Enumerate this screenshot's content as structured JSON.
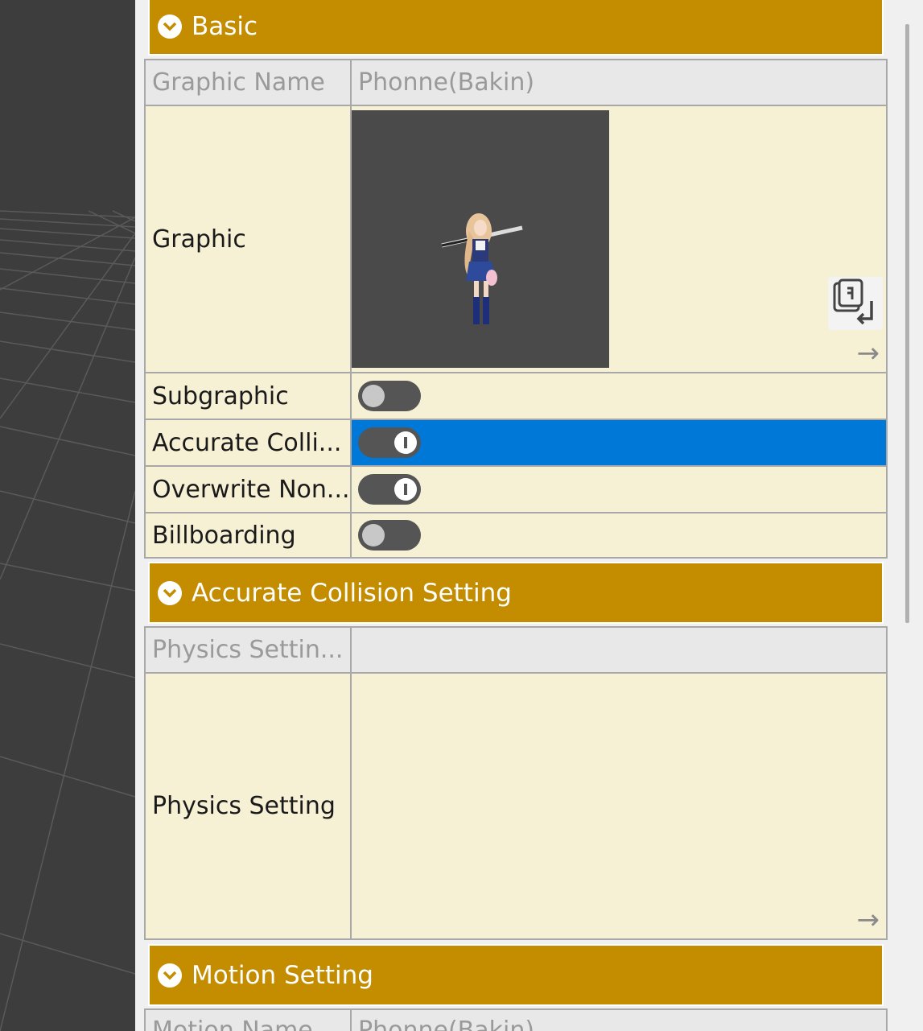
{
  "sections": {
    "basic": {
      "title": "Basic"
    },
    "collision": {
      "title": "Accurate Collision Setting"
    },
    "motion": {
      "title": "Motion Setting"
    }
  },
  "rows": {
    "graphic_name": {
      "label": "Graphic Name",
      "value": "Phonne(Bakin)"
    },
    "graphic": {
      "label": "Graphic"
    },
    "subgraphic": {
      "label": "Subgraphic",
      "state": "off"
    },
    "accurate_collision": {
      "label": "Accurate Colli...",
      "state": "on"
    },
    "overwrite_non": {
      "label": "Overwrite Non...",
      "state": "on"
    },
    "billboarding": {
      "label": "Billboarding",
      "state": "off"
    },
    "physics_settin": {
      "label": "Physics Settin...",
      "value": ""
    },
    "physics_setting": {
      "label": "Physics Setting"
    },
    "motion_name": {
      "label": "Motion Name",
      "value": "Phonne(Bakin)"
    }
  },
  "icons": {
    "chevron": "chevron-down-icon",
    "swap": "swap-graphic-icon",
    "arrow": "arrow-right-icon"
  },
  "colors": {
    "section_header": "#c48d00",
    "selection": "#0078d7",
    "row_cream": "#f6f0d4",
    "row_disabled": "#e8e8e8",
    "viewport": "#3d3d3d"
  }
}
